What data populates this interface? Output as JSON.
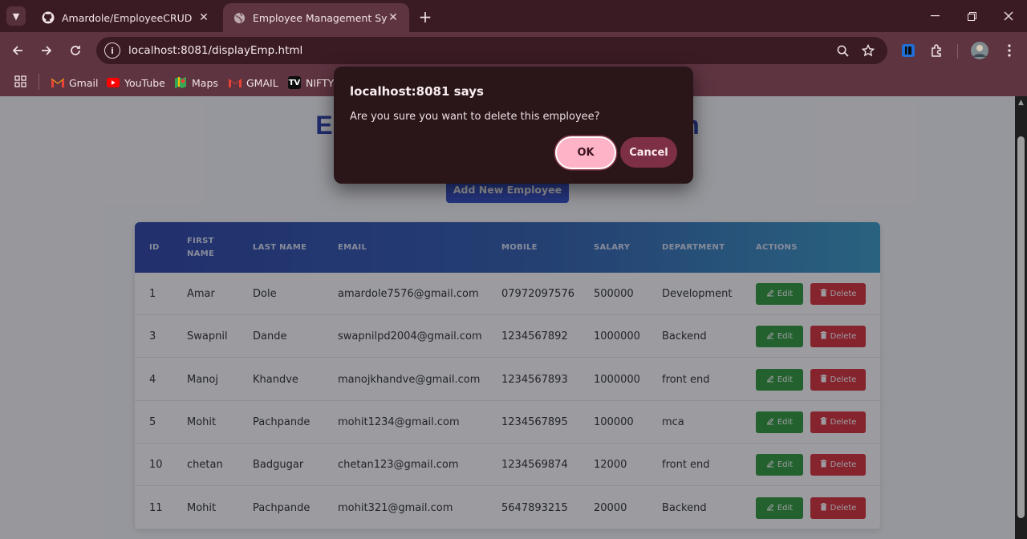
{
  "browser": {
    "tabs": [
      {
        "title": "Amardole/EmployeeCRUD",
        "icon": "github-icon",
        "active": false
      },
      {
        "title": "Employee Management System",
        "icon": "globe-icon",
        "active": true
      }
    ],
    "url": "localhost:8081/displayEmp.html",
    "bookmarks": [
      {
        "label": "Gmail",
        "icon": "gmail-icon"
      },
      {
        "label": "YouTube",
        "icon": "youtube-icon"
      },
      {
        "label": "Maps",
        "icon": "maps-icon"
      },
      {
        "label": "GMAIL",
        "icon": "gmail-icon"
      },
      {
        "label": "NIFTY",
        "icon": "tradingview-icon"
      }
    ]
  },
  "page": {
    "title": "Employee Management System",
    "add_button": "Add New Employee",
    "columns": [
      "ID",
      "FIRST NAME",
      "LAST NAME",
      "EMAIL",
      "MOBILE",
      "SALARY",
      "DEPARTMENT",
      "ACTIONS"
    ],
    "edit_label": "Edit",
    "delete_label": "Delete",
    "rows": [
      {
        "id": "1",
        "first": "Amar",
        "last": "Dole",
        "email": "amardole7576@gmail.com",
        "mobile": "07972097576",
        "salary": "500000",
        "dept": "Development"
      },
      {
        "id": "3",
        "first": "Swapnil",
        "last": "Dande",
        "email": "swapnilpd2004@gmail.com",
        "mobile": "1234567892",
        "salary": "1000000",
        "dept": "Backend"
      },
      {
        "id": "4",
        "first": "Manoj",
        "last": "Khandve",
        "email": "manojkhandve@gmail.com",
        "mobile": "1234567893",
        "salary": "1000000",
        "dept": "front end"
      },
      {
        "id": "5",
        "first": "Mohit",
        "last": "Pachpande",
        "email": "mohit1234@gmail.com",
        "mobile": "1234567895",
        "salary": "100000",
        "dept": "mca"
      },
      {
        "id": "10",
        "first": "chetan",
        "last": "Badgugar",
        "email": "chetan123@gmail.com",
        "mobile": "1234569874",
        "salary": "12000",
        "dept": "front end"
      },
      {
        "id": "11",
        "first": "Mohit",
        "last": "Pachpande",
        "email": "mohit321@gmail.com",
        "mobile": "5647893215",
        "salary": "20000",
        "dept": "Backend"
      }
    ]
  },
  "dialog": {
    "title": "localhost:8081 says",
    "message": "Are you sure you want to delete this employee?",
    "ok": "OK",
    "cancel": "Cancel"
  },
  "colors": {
    "accent": "#3550c8",
    "edit": "#2f9a3c",
    "delete": "#d9313c",
    "ok_button": "#ffb3c6",
    "cancel_button": "#7c2f45"
  }
}
